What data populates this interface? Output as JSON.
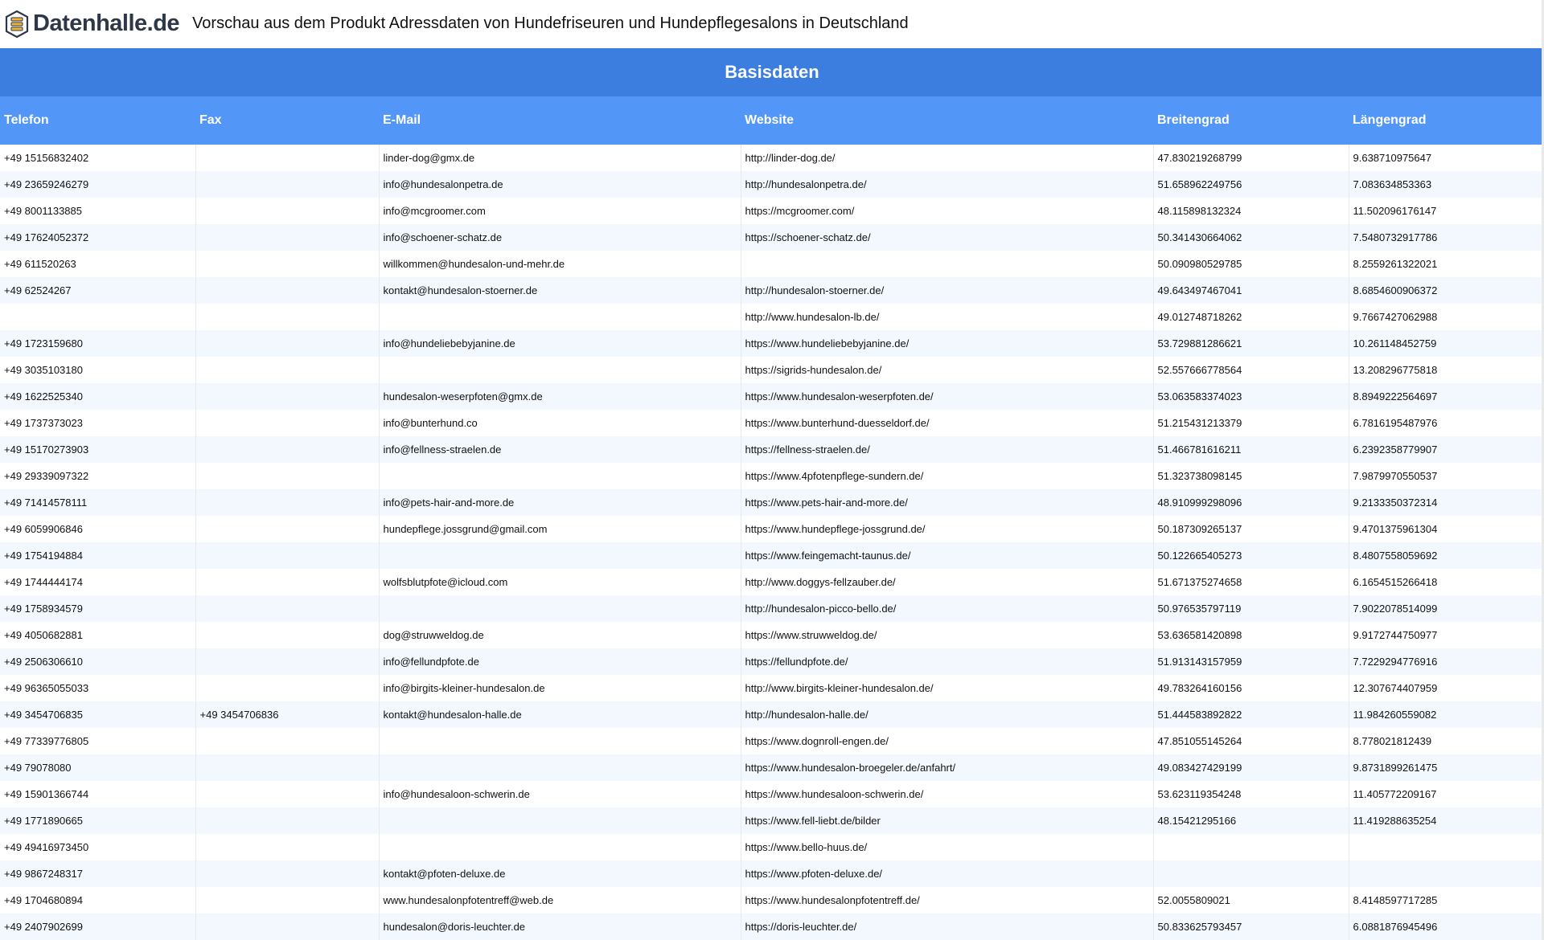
{
  "header": {
    "logo_text": "Datenhalle.de",
    "title": "Vorschau aus dem Produkt Adressdaten von Hundefriseuren und Hundepflegesalons in Deutschland"
  },
  "section": {
    "title": "Basisdaten"
  },
  "table": {
    "columns": [
      "Telefon",
      "Fax",
      "E-Mail",
      "Website",
      "Breitengrad",
      "Längengrad"
    ],
    "rows": [
      [
        "+49 15156832402",
        "",
        "linder-dog@gmx.de",
        "http://linder-dog.de/",
        "47.830219268799",
        "9.638710975647"
      ],
      [
        "+49 23659246279",
        "",
        "info@hundesalonpetra.de",
        "http://hundesalonpetra.de/",
        "51.658962249756",
        "7.083634853363"
      ],
      [
        "+49 8001133885",
        "",
        "info@mcgroomer.com",
        "https://mcgroomer.com/",
        "48.115898132324",
        "11.502096176147"
      ],
      [
        "+49 17624052372",
        "",
        "info@schoener-schatz.de",
        "https://schoener-schatz.de/",
        "50.341430664062",
        "7.5480732917786"
      ],
      [
        "+49 611520263",
        "",
        "willkommen@hundesalon-und-mehr.de",
        "",
        "50.090980529785",
        "8.2559261322021"
      ],
      [
        "+49 62524267",
        "",
        "kontakt@hundesalon-stoerner.de",
        "http://hundesalon-stoerner.de/",
        "49.643497467041",
        "8.6854600906372"
      ],
      [
        "",
        "",
        "",
        "http://www.hundesalon-lb.de/",
        "49.012748718262",
        "9.7667427062988"
      ],
      [
        "+49 1723159680",
        "",
        "info@hundeliebebyjanine.de",
        "https://www.hundeliebebyjanine.de/",
        "53.729881286621",
        "10.261148452759"
      ],
      [
        "+49 3035103180",
        "",
        "",
        "https://sigrids-hundesalon.de/",
        "52.557666778564",
        "13.208296775818"
      ],
      [
        "+49 1622525340",
        "",
        "hundesalon-weserpfoten@gmx.de",
        "https://www.hundesalon-weserpfoten.de/",
        "53.063583374023",
        "8.8949222564697"
      ],
      [
        "+49 1737373023",
        "",
        "info@bunterhund.co",
        "https://www.bunterhund-duesseldorf.de/",
        "51.215431213379",
        "6.7816195487976"
      ],
      [
        "+49 15170273903",
        "",
        "info@fellness-straelen.de",
        "https://fellness-straelen.de/",
        "51.466781616211",
        "6.2392358779907"
      ],
      [
        "+49 29339097322",
        "",
        "",
        "https://www.4pfotenpflege-sundern.de/",
        "51.323738098145",
        "7.9879970550537"
      ],
      [
        "+49 71414578111",
        "",
        "info@pets-hair-and-more.de",
        "https://www.pets-hair-and-more.de/",
        "48.910999298096",
        "9.2133350372314"
      ],
      [
        "+49 6059906846",
        "",
        "hundepflege.jossgrund@gmail.com",
        "https://www.hundepflege-jossgrund.de/",
        "50.187309265137",
        "9.4701375961304"
      ],
      [
        "+49 1754194884",
        "",
        "",
        "https://www.feingemacht-taunus.de/",
        "50.122665405273",
        "8.4807558059692"
      ],
      [
        "+49 1744444174",
        "",
        "wolfsblutpfote@icloud.com",
        "http://www.doggys-fellzauber.de/",
        "51.671375274658",
        "6.1654515266418"
      ],
      [
        "+49 1758934579",
        "",
        "",
        "http://hundesalon-picco-bello.de/",
        "50.976535797119",
        "7.9022078514099"
      ],
      [
        "+49 4050682881",
        "",
        "dog@struwweldog.de",
        "https://www.struwweldog.de/",
        "53.636581420898",
        "9.9172744750977"
      ],
      [
        "+49 2506306610",
        "",
        "info@fellundpfote.de",
        "https://fellundpfote.de/",
        "51.913143157959",
        "7.7229294776916"
      ],
      [
        "+49 96365055033",
        "",
        "info@birgits-kleiner-hundesalon.de",
        "http://www.birgits-kleiner-hundesalon.de/",
        "49.783264160156",
        "12.307674407959"
      ],
      [
        "+49 3454706835",
        "+49 3454706836",
        "kontakt@hundesalon-halle.de",
        "http://hundesalon-halle.de/",
        "51.444583892822",
        "11.984260559082"
      ],
      [
        "+49 77339776805",
        "",
        "",
        "https://www.dognroll-engen.de/",
        "47.851055145264",
        "8.778021812439"
      ],
      [
        "+49 79078080",
        "",
        "",
        "https://www.hundesalon-broegeler.de/anfahrt/",
        "49.083427429199",
        "9.8731899261475"
      ],
      [
        "+49 15901366744",
        "",
        "info@hundesaloon-schwerin.de",
        "https://www.hundesaloon-schwerin.de/",
        "53.623119354248",
        "11.405772209167"
      ],
      [
        "+49 1771890665",
        "",
        "",
        "https://www.fell-liebt.de/bilder",
        "48.15421295166",
        "11.419288635254"
      ],
      [
        "+49 49416973450",
        "",
        "",
        "https://www.bello-huus.de/",
        "",
        ""
      ],
      [
        "+49 9867248317",
        "",
        "kontakt@pfoten-deluxe.de",
        "https://www.pfoten-deluxe.de/",
        "",
        ""
      ],
      [
        "+49 1704680894",
        "",
        "www.hundesalonpfotentreff@web.de",
        "https://www.hundesalonpfotentreff.de/",
        "52.0055809021",
        "8.4148597717285"
      ],
      [
        "+49 2407902699",
        "",
        "hundesalon@doris-leuchter.de",
        "https://doris-leuchter.de/",
        "50.833625793457",
        "6.0881876945496"
      ]
    ]
  }
}
